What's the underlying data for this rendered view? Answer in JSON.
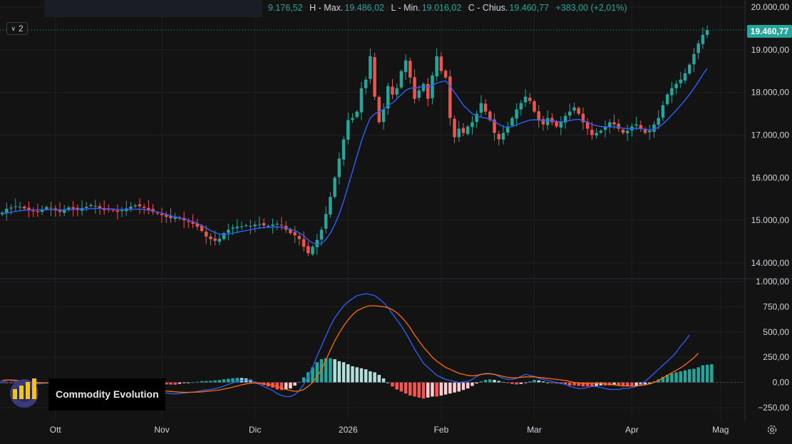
{
  "header": {
    "ohlc": {
      "open_value": "9.176,52",
      "high_label": "H - Max.",
      "high_value": "19.486,02",
      "low_label": "L - Min.",
      "low_value": "19.016,02",
      "close_label": "C - Chius.",
      "close_value": "19.460,77",
      "change_value": "+383,00 (+2,01%)"
    },
    "collapse_count": "2"
  },
  "last_price_label": "19.460,77",
  "watermark": {
    "text": "Commodity Evolution"
  },
  "colors": {
    "up": "#26a69a",
    "down": "#ef5350",
    "ma": "#2962ff",
    "macd": "#2962ff",
    "signal": "#ff6d00",
    "hist_pos_strong": "#26a69a",
    "hist_pos_weak": "#b2dfdb",
    "hist_neg_strong": "#ff5252",
    "hist_neg_weak": "#ffcdd2"
  },
  "chart_data": [
    {
      "type": "candlestick",
      "price_axis_ticks": [
        "20.000,00",
        "19.000,00",
        "18.000,00",
        "17.000,00",
        "16.000,00",
        "15.000,00",
        "14.000,00"
      ],
      "price_axis_values": [
        20000,
        19000,
        18000,
        17000,
        16000,
        15000,
        14000
      ],
      "ylim": [
        13700,
        20100
      ],
      "x_labels": [
        "Ott",
        "Nov",
        "Dic",
        "2026",
        "Feb",
        "Mar",
        "Apr",
        "Mag"
      ],
      "x_label_index": [
        12,
        36,
        57,
        78,
        99,
        120,
        142,
        162
      ],
      "num_slots": 168,
      "last_price": 19460.77,
      "closes": [
        15180,
        15270,
        15300,
        15330,
        15320,
        15280,
        15250,
        15220,
        15190,
        15240,
        15310,
        15280,
        15230,
        15200,
        15250,
        15300,
        15270,
        15240,
        15290,
        15320,
        15360,
        15340,
        15280,
        15240,
        15260,
        15230,
        15200,
        15240,
        15280,
        15320,
        15350,
        15330,
        15290,
        15250,
        15200,
        15160,
        15120,
        15080,
        15050,
        15070,
        15040,
        15000,
        14970,
        14920,
        14850,
        14750,
        14620,
        14560,
        14520,
        14570,
        14700,
        14780,
        14830,
        14850,
        14860,
        14880,
        14870,
        14900,
        14910,
        14880,
        14870,
        14900,
        14920,
        14880,
        14780,
        14700,
        14650,
        14560,
        14380,
        14230,
        14380,
        14540,
        14780,
        15150,
        15550,
        16000,
        16450,
        16900,
        17350,
        17400,
        17550,
        18100,
        18300,
        18850,
        17900,
        17300,
        17600,
        18150,
        17950,
        18100,
        18500,
        18750,
        18350,
        17850,
        18050,
        18200,
        17850,
        18400,
        18850,
        18500,
        18350,
        17400,
        16950,
        17150,
        17050,
        17200,
        17300,
        17500,
        17750,
        17550,
        17350,
        17050,
        16900,
        17050,
        17200,
        17400,
        17600,
        17750,
        17900,
        17800,
        17550,
        17350,
        17250,
        17400,
        17300,
        17200,
        17300,
        17450,
        17550,
        17650,
        17500,
        17300,
        17150,
        17000,
        17050,
        17100,
        17200,
        17300,
        17250,
        17150,
        17050,
        17100,
        17200,
        17250,
        17150,
        17050,
        17100,
        17250,
        17400,
        17700,
        17950,
        18100,
        18200,
        18300,
        18450,
        18650,
        18900,
        19150,
        19350,
        19460.77
      ],
      "ma": [
        15150,
        15170,
        15190,
        15210,
        15225,
        15235,
        15240,
        15245,
        15245,
        15245,
        15250,
        15250,
        15250,
        15245,
        15245,
        15250,
        15255,
        15255,
        15260,
        15265,
        15275,
        15280,
        15280,
        15275,
        15270,
        15265,
        15255,
        15250,
        15250,
        15255,
        15260,
        15260,
        15255,
        15240,
        15220,
        15195,
        15170,
        15140,
        15110,
        15085,
        15060,
        15035,
        15005,
        14970,
        14930,
        14880,
        14820,
        14760,
        14710,
        14680,
        14670,
        14680,
        14700,
        14720,
        14740,
        14760,
        14780,
        14800,
        14820,
        14830,
        14835,
        14840,
        14845,
        14840,
        14820,
        14790,
        14760,
        14710,
        14640,
        14540,
        14470,
        14440,
        14460,
        14550,
        14700,
        14900,
        15150,
        15450,
        15800,
        16150,
        16500,
        16850,
        17150,
        17400,
        17500,
        17550,
        17600,
        17700,
        17750,
        17850,
        17950,
        18050,
        18100,
        18100,
        18120,
        18140,
        18130,
        18160,
        18220,
        18250,
        18270,
        18150,
        18000,
        17850,
        17700,
        17600,
        17500,
        17450,
        17420,
        17400,
        17370,
        17320,
        17250,
        17200,
        17180,
        17200,
        17240,
        17280,
        17320,
        17350,
        17360,
        17350,
        17340,
        17350,
        17340,
        17320,
        17310,
        17320,
        17340,
        17360,
        17370,
        17340,
        17300,
        17250,
        17220,
        17200,
        17190,
        17190,
        17190,
        17180,
        17160,
        17150,
        17150,
        17160,
        17150,
        17130,
        17120,
        17140,
        17180,
        17260,
        17360,
        17470,
        17580,
        17700,
        17820,
        17950,
        18100,
        18250,
        18420,
        18560
      ]
    },
    {
      "type": "line",
      "title": "",
      "ylim": [
        -300,
        1000
      ],
      "axis_ticks": [
        "1.000,00",
        "750,00",
        "500,00",
        "250,00",
        "0,00",
        "−250,00"
      ],
      "axis_values": [
        1000,
        750,
        500,
        250,
        0,
        -250
      ],
      "series": [
        {
          "values": [
            15,
            25,
            20,
            10,
            5,
            0,
            -5,
            -10,
            -15,
            -10,
            -5,
            0,
            5,
            -5,
            -15,
            -25,
            -35,
            -45,
            -55,
            -65,
            -70,
            -80,
            -95,
            -110,
            -120,
            -115,
            -100,
            -90,
            -80,
            -70,
            -60,
            -60,
            -60,
            -70,
            -80,
            -90,
            -100,
            -105,
            -110,
            -115,
            -110,
            -105,
            -100,
            -95,
            -90,
            -80,
            -75,
            -70,
            -60,
            -50,
            -35,
            -20,
            -5,
            10,
            20,
            25,
            20,
            0,
            -20,
            -40,
            -60,
            -80,
            -110,
            -130,
            -140,
            -140,
            -120,
            -80,
            -20,
            60,
            150,
            260,
            360,
            460,
            560,
            640,
            700,
            760,
            800,
            830,
            860,
            870,
            880,
            870,
            860,
            830,
            790,
            740,
            680,
            620,
            560,
            490,
            410,
            330,
            260,
            190,
            150,
            110,
            70,
            50,
            30,
            20,
            10,
            0,
            5,
            10,
            30,
            60,
            80,
            90,
            90,
            80,
            60,
            40,
            30,
            30,
            40,
            60,
            80,
            70,
            60,
            40,
            30,
            20,
            10,
            0,
            -10,
            -20,
            -40,
            -50,
            -60,
            -60,
            -50,
            -40,
            -40,
            -50,
            -60,
            -70,
            -70,
            -70,
            -60,
            -60,
            -50,
            -40,
            -20,
            10,
            50,
            90,
            130,
            170,
            210,
            250,
            300,
            360,
            410,
            470
          ]
        },
        {
          "values": [
            20,
            25,
            25,
            22,
            18,
            14,
            9,
            5,
            0,
            -3,
            -5,
            -6,
            -5,
            -6,
            -8,
            -12,
            -17,
            -23,
            -30,
            -36,
            -43,
            -50,
            -58,
            -67,
            -76,
            -83,
            -87,
            -88,
            -86,
            -83,
            -79,
            -75,
            -72,
            -71,
            -73,
            -76,
            -80,
            -85,
            -89,
            -93,
            -96,
            -98,
            -98,
            -97,
            -96,
            -93,
            -89,
            -85,
            -80,
            -74,
            -66,
            -57,
            -46,
            -35,
            -24,
            -15,
            -8,
            -6,
            -9,
            -14,
            -20,
            -28,
            -40,
            -55,
            -68,
            -80,
            -88,
            -85,
            -70,
            -40,
            0,
            60,
            130,
            220,
            320,
            410,
            490,
            560,
            620,
            670,
            710,
            730,
            750,
            760,
            760,
            755,
            750,
            740,
            720,
            690,
            650,
            600,
            540,
            470,
            410,
            350,
            300,
            250,
            210,
            180,
            150,
            130,
            110,
            90,
            80,
            70,
            65,
            70,
            80,
            85,
            85,
            80,
            70,
            60,
            50,
            45,
            45,
            50,
            55,
            55,
            55,
            50,
            45,
            40,
            35,
            30,
            25,
            20,
            10,
            0,
            -5,
            -10,
            -10,
            -10,
            -10,
            -10,
            -15,
            -20,
            -25,
            -30,
            -35,
            -35,
            -35,
            -35,
            -30,
            -25,
            -15,
            0,
            20,
            45,
            70,
            95,
            120,
            145,
            175,
            210,
            245,
            290
          ]
        }
      ],
      "histogram": [
        -5,
        0,
        -5,
        -12,
        -13,
        -14,
        -14,
        -15,
        -15,
        -7,
        0,
        6,
        10,
        1,
        -7,
        -13,
        -18,
        -22,
        -25,
        -29,
        -27,
        -30,
        -37,
        -43,
        -44,
        -32,
        -13,
        -2,
        6,
        13,
        19,
        15,
        12,
        1,
        -7,
        -14,
        -20,
        -20,
        -21,
        -22,
        -14,
        -7,
        -2,
        2,
        6,
        13,
        14,
        15,
        20,
        24,
        31,
        37,
        41,
        45,
        44,
        40,
        28,
        6,
        -11,
        -26,
        -40,
        -52,
        -70,
        -75,
        -72,
        -60,
        -32,
        5,
        50,
        100,
        150,
        200,
        230,
        240,
        240,
        230,
        210,
        200,
        180,
        160,
        150,
        140,
        130,
        110,
        100,
        75,
        40,
        0,
        -40,
        -70,
        -90,
        -110,
        -130,
        -140,
        -150,
        -160,
        -150,
        -140,
        -140,
        -130,
        -120,
        -110,
        -100,
        -90,
        -75,
        -60,
        -35,
        -10,
        10,
        25,
        30,
        25,
        15,
        5,
        -5,
        -15,
        -20,
        -15,
        -5,
        10,
        25,
        20,
        10,
        0,
        -5,
        -10,
        -15,
        -20,
        -30,
        -30,
        -35,
        -40,
        -40,
        -40,
        -35,
        -30,
        -30,
        -30,
        -25,
        -30,
        -35,
        -40,
        -40,
        -35,
        -30,
        -20,
        -10,
        10,
        30,
        55,
        75,
        90,
        100,
        110,
        120,
        130,
        135,
        150,
        170,
        175,
        180
      ]
    }
  ]
}
